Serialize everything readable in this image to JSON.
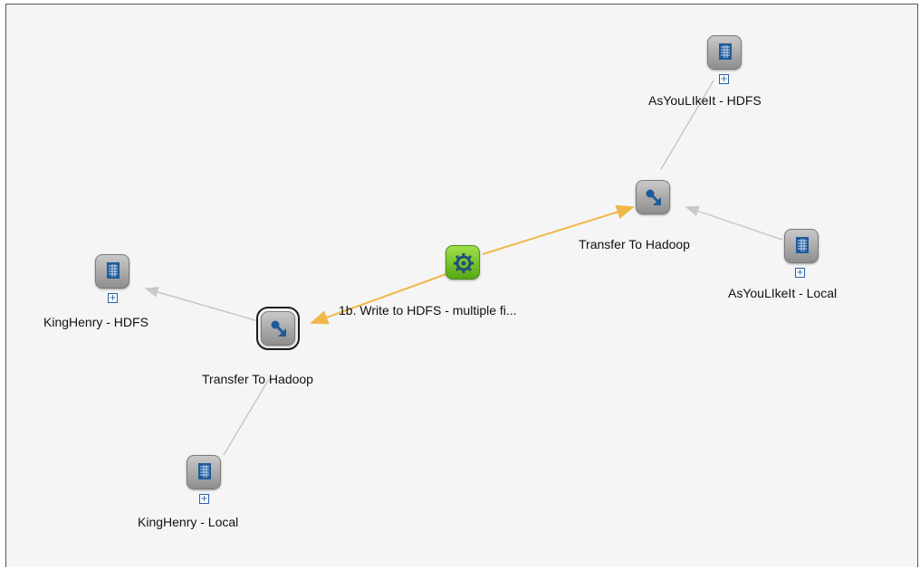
{
  "workflow": {
    "nodes": [
      {
        "id": "asyoulikeit-hdfs",
        "type": "dataset",
        "label": "AsYouLIkeIt - HDFS"
      },
      {
        "id": "transfer-right",
        "type": "transfer",
        "label": "Transfer To Hadoop"
      },
      {
        "id": "asyoulikeit-local",
        "type": "dataset",
        "label": "AsYouLIkeIt - Local"
      },
      {
        "id": "write-hdfs",
        "type": "process",
        "label": "1b. Write to HDFS - multiple fi..."
      },
      {
        "id": "kinghenry-hdfs",
        "type": "dataset",
        "label": "KingHenry - HDFS"
      },
      {
        "id": "transfer-left",
        "type": "transfer",
        "label": "Transfer To Hadoop",
        "selected": true
      },
      {
        "id": "kinghenry-local",
        "type": "dataset",
        "label": "KingHenry - Local"
      }
    ],
    "edge_colors": {
      "data": "#c8c8c8",
      "control": "#f0b84a"
    },
    "colors": {
      "process": "#6cc628",
      "node": "#9a9a9a",
      "icon_glyph": "#1f5b9a"
    }
  }
}
